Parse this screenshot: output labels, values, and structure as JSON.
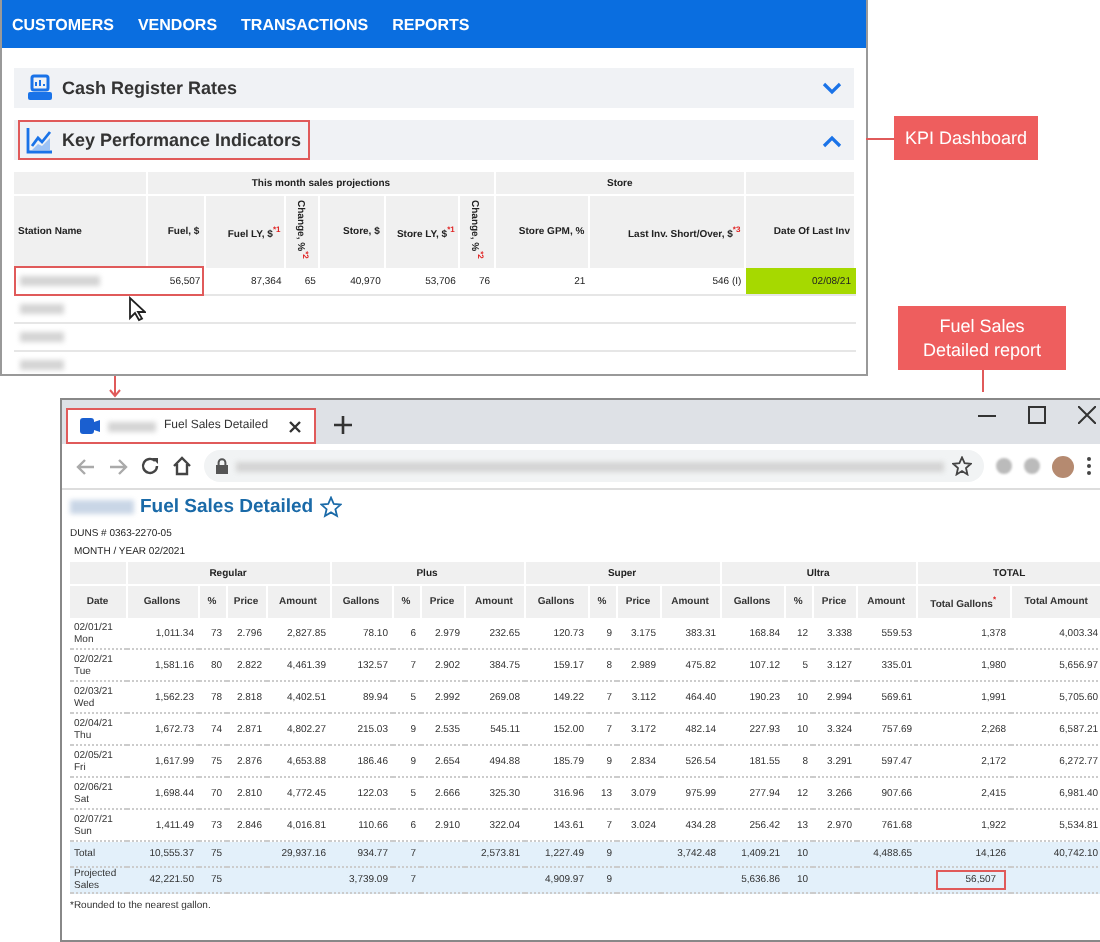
{
  "kpi_page": {
    "nav": [
      {
        "label": "CUSTOMERS"
      },
      {
        "label": "VENDORS"
      },
      {
        "label": "TRANSACTIONS"
      },
      {
        "label": "REPORTS"
      }
    ],
    "sections": [
      {
        "kind": "register",
        "title": "Cash Register Rates",
        "expanded": false,
        "highlighted": false
      },
      {
        "kind": "chart",
        "title": "Key Performance Indicators",
        "expanded": true,
        "highlighted": true
      }
    ],
    "kpi_table": {
      "group_headers": [
        {
          "label": "This month sales projections"
        },
        {
          "label": "Store"
        }
      ],
      "columns": [
        {
          "label": "Station Name",
          "kind": "text"
        },
        {
          "label": "Fuel, $",
          "kind": "num"
        },
        {
          "label": "Fuel LY, $$^{*1}$",
          "kind": "num"
        },
        {
          "label": "Change, %$^{*2}$",
          "kind": "vertical"
        },
        {
          "label": "Store, $",
          "kind": "num"
        },
        {
          "label": "Store LY, $$^{*1}$",
          "kind": "num"
        },
        {
          "label": "Change, %$^{*2}$",
          "kind": "vertical"
        },
        {
          "label": "Store GPM, %",
          "kind": "num"
        },
        {
          "label": "Last Inv. Short/Over, $$^{*3}$",
          "kind": "num"
        },
        {
          "label": "Date Of Last Inv",
          "kind": "num"
        }
      ],
      "rows": [
        {
          "cells": [
            "56,507",
            "87,364",
            "65",
            "40,970",
            "53,706",
            "76",
            "21",
            "546 (I)",
            "02/08/21"
          ],
          "highlighted": true,
          "date_highlighted": true
        },
        {
          "highlighted": false
        },
        {
          "highlighted": false
        },
        {
          "highlighted": false
        }
      ]
    }
  },
  "annotations": [
    {
      "text": "KPI Dashboard"
    },
    {
      "text": "Fuel Sales Detailed report"
    }
  ],
  "browser": {
    "tab": {
      "title": "Fuel Sales Detailed",
      "selected": true,
      "highlighted": true
    },
    "page": {
      "title": "Fuel Sales Detailed",
      "duns": "DUNS # 0363-2270-05",
      "month": "MONTH / YEAR 02/2021",
      "table": {
        "groups": [
          "Regular",
          "Plus",
          "Super",
          "Ultra",
          "TOTAL"
        ],
        "columns": [
          "Date",
          "Gallons",
          "%",
          "Price",
          "Amount",
          "Gallons",
          "%",
          "Price",
          "Amount",
          "Gallons",
          "%",
          "Price",
          "Amount",
          "Gallons",
          "%",
          "Price",
          "Amount",
          "Total Gallons$^{*}$",
          "Total Amount"
        ],
        "rows": [
          {
            "kind": "day",
            "cells": [
              "02/01/21 Mon",
              "1,011.34",
              "73",
              "2.796",
              "2,827.85",
              "78.10",
              "6",
              "2.979",
              "232.65",
              "120.73",
              "9",
              "3.175",
              "383.31",
              "168.84",
              "12",
              "3.338",
              "559.53",
              "1,378",
              "4,003.34"
            ]
          },
          {
            "kind": "day",
            "cells": [
              "02/02/21 Tue",
              "1,581.16",
              "80",
              "2.822",
              "4,461.39",
              "132.57",
              "7",
              "2.902",
              "384.75",
              "159.17",
              "8",
              "2.989",
              "475.82",
              "107.12",
              "5",
              "3.127",
              "335.01",
              "1,980",
              "5,656.97"
            ]
          },
          {
            "kind": "day",
            "cells": [
              "02/03/21 Wed",
              "1,562.23",
              "78",
              "2.818",
              "4,402.51",
              "89.94",
              "5",
              "2.992",
              "269.08",
              "149.22",
              "7",
              "3.112",
              "464.40",
              "190.23",
              "10",
              "2.994",
              "569.61",
              "1,991",
              "5,705.60"
            ]
          },
          {
            "kind": "day",
            "cells": [
              "02/04/21 Thu",
              "1,672.73",
              "74",
              "2.871",
              "4,802.27",
              "215.03",
              "9",
              "2.535",
              "545.11",
              "152.00",
              "7",
              "3.172",
              "482.14",
              "227.93",
              "10",
              "3.324",
              "757.69",
              "2,268",
              "6,587.21"
            ]
          },
          {
            "kind": "day",
            "cells": [
              "02/05/21 Fri",
              "1,617.99",
              "75",
              "2.876",
              "4,653.88",
              "186.46",
              "9",
              "2.654",
              "494.88",
              "185.79",
              "9",
              "2.834",
              "526.54",
              "181.55",
              "8",
              "3.291",
              "597.47",
              "2,172",
              "6,272.77"
            ]
          },
          {
            "kind": "day",
            "cells": [
              "02/06/21 Sat",
              "1,698.44",
              "70",
              "2.810",
              "4,772.45",
              "122.03",
              "5",
              "2.666",
              "325.30",
              "316.96",
              "13",
              "3.079",
              "975.99",
              "277.94",
              "12",
              "3.266",
              "907.66",
              "2,415",
              "6,981.40"
            ]
          },
          {
            "kind": "day",
            "cells": [
              "02/07/21 Sun",
              "1,411.49",
              "73",
              "2.846",
              "4,016.81",
              "110.66",
              "6",
              "2.910",
              "322.04",
              "143.61",
              "7",
              "3.024",
              "434.28",
              "256.42",
              "13",
              "2.970",
              "761.68",
              "1,922",
              "5,534.81"
            ]
          },
          {
            "kind": "summary",
            "cells": [
              "Total",
              "10,555.37",
              "75",
              "",
              "29,937.16",
              "934.77",
              "7",
              "",
              "2,573.81",
              "1,227.49",
              "9",
              "",
              "3,742.48",
              "1,409.21",
              "10",
              "",
              "4,488.65",
              "14,126",
              "40,742.10"
            ]
          },
          {
            "kind": "summary",
            "cells": [
              "Projected Sales",
              "42,221.50",
              "75",
              "",
              "",
              "3,739.09",
              "7",
              "",
              "",
              "4,909.97",
              "9",
              "",
              "",
              "5,636.86",
              "10",
              "",
              "",
              {
                "text": "56,507",
                "highlighted": true
              },
              ""
            ]
          }
        ]
      },
      "footnote": "*Rounded to the nearest gallon."
    }
  }
}
